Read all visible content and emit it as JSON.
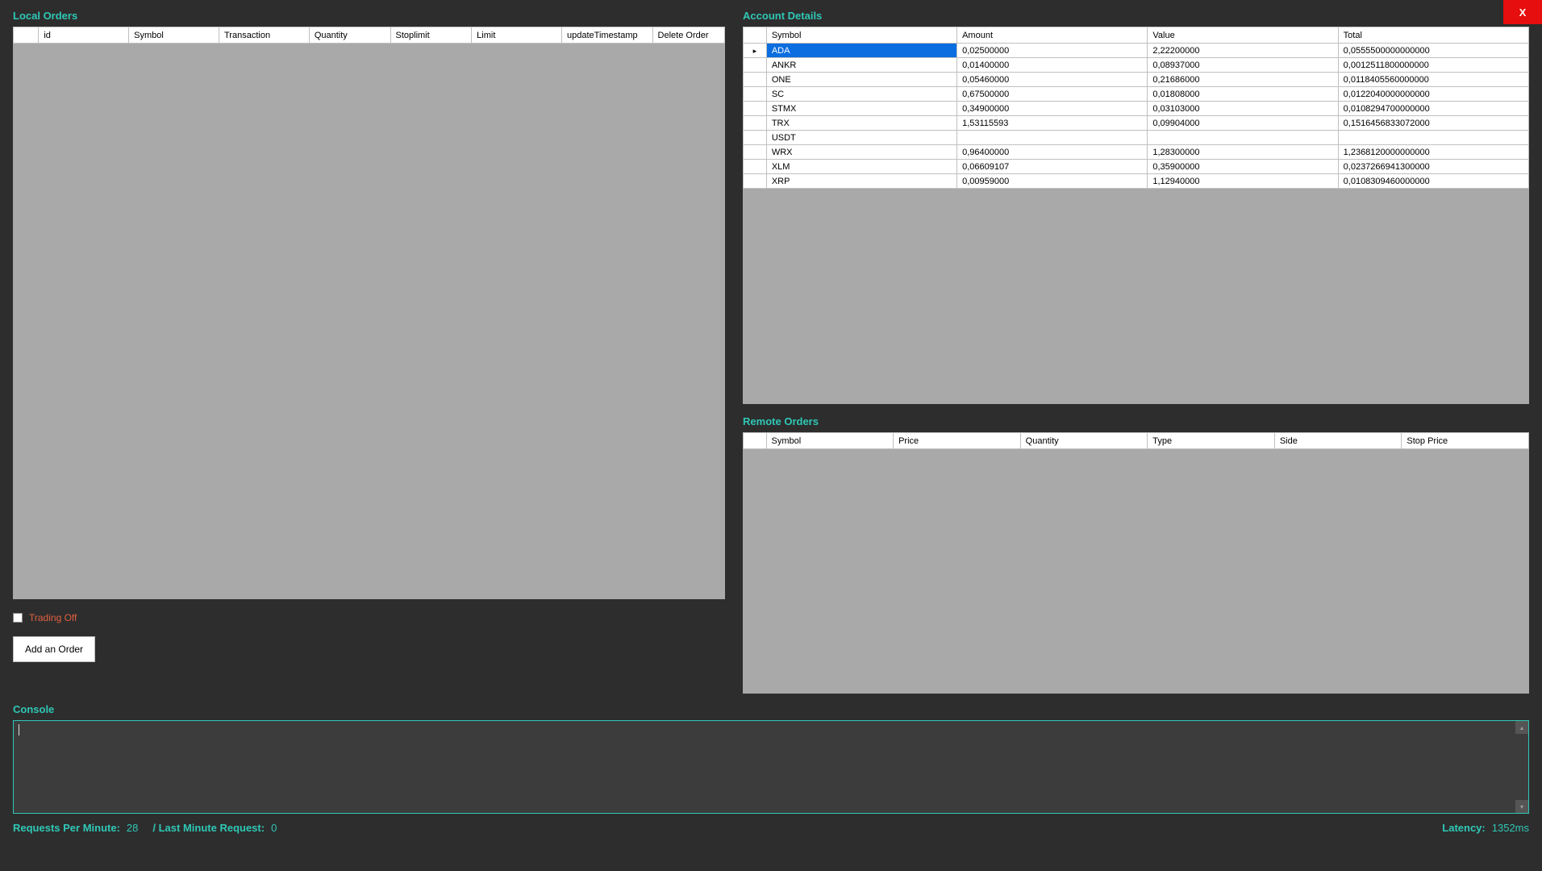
{
  "close_label": "X",
  "local_orders": {
    "title": "Local Orders",
    "columns": [
      "id",
      "Symbol",
      "Transaction",
      "Quantity",
      "Stoplimit",
      "Limit",
      "updateTimestamp",
      "Delete Order"
    ],
    "rows": []
  },
  "trading_toggle": {
    "label": "Trading Off",
    "checked": false
  },
  "add_order_button": "Add an  Order",
  "account_details": {
    "title": "Account Details",
    "columns": [
      "Symbol",
      "Amount",
      "Value",
      "Total"
    ],
    "rows": [
      {
        "symbol": "ADA",
        "amount": "0,02500000",
        "value": "2,22200000",
        "total": "0,0555500000000000",
        "selected": true
      },
      {
        "symbol": "ANKR",
        "amount": "0,01400000",
        "value": "0,08937000",
        "total": "0,0012511800000000"
      },
      {
        "symbol": "ONE",
        "amount": "0,05460000",
        "value": "0,21686000",
        "total": "0,0118405560000000"
      },
      {
        "symbol": "SC",
        "amount": "0,67500000",
        "value": "0,01808000",
        "total": "0,0122040000000000"
      },
      {
        "symbol": "STMX",
        "amount": "0,34900000",
        "value": "0,03103000",
        "total": "0,0108294700000000"
      },
      {
        "symbol": "TRX",
        "amount": "1,53115593",
        "value": "0,09904000",
        "total": "0,1516456833072000"
      },
      {
        "symbol": "USDT",
        "amount": "",
        "value": "",
        "total": ""
      },
      {
        "symbol": "WRX",
        "amount": "0,96400000",
        "value": "1,28300000",
        "total": "1,2368120000000000"
      },
      {
        "symbol": "XLM",
        "amount": "0,06609107",
        "value": "0,35900000",
        "total": "0,0237266941300000"
      },
      {
        "symbol": "XRP",
        "amount": "0,00959000",
        "value": "1,12940000",
        "total": "0,0108309460000000"
      }
    ]
  },
  "remote_orders": {
    "title": "Remote Orders",
    "columns": [
      "Symbol",
      "Price",
      "Quantity",
      "Type",
      "Side",
      "Stop Price"
    ],
    "rows": []
  },
  "console": {
    "title": "Console",
    "content": ""
  },
  "status": {
    "requests_per_minute_label": "Requests Per Minute:",
    "requests_per_minute_value": "28",
    "last_minute_request_label": "/ Last Minute Request:",
    "last_minute_request_value": "0",
    "latency_label": "Latency:",
    "latency_value": "1352ms"
  }
}
